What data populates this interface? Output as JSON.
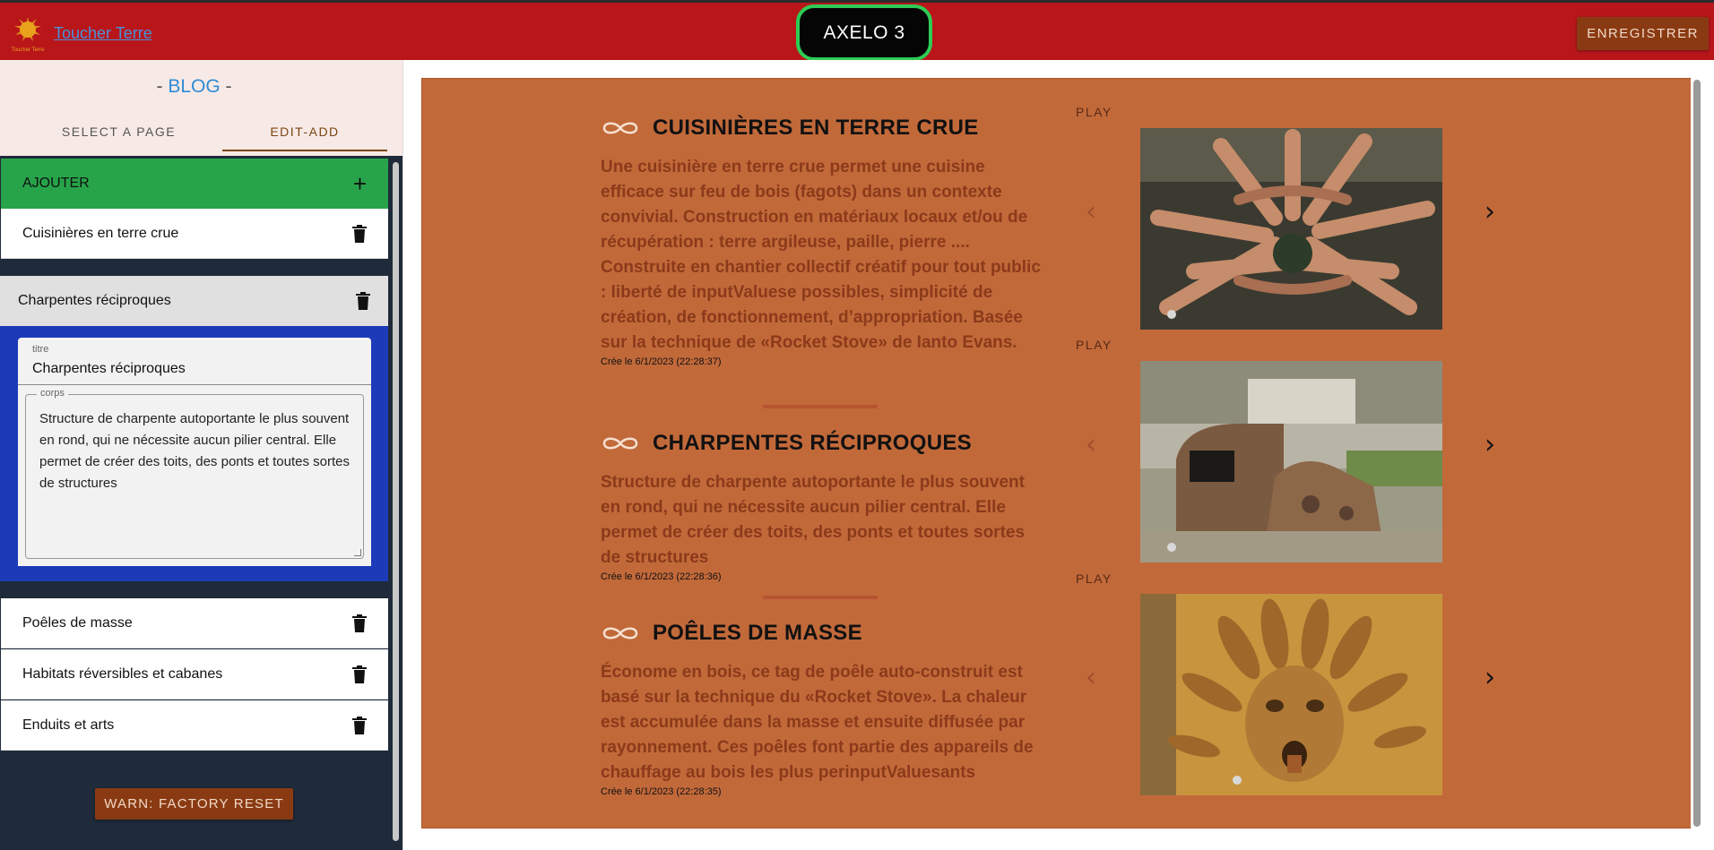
{
  "header": {
    "site_link": "Toucher Terre",
    "logo_text": "Toucher Terre",
    "center_badge": "AXELO 3",
    "save_label": "ENREGISTRER"
  },
  "sidebar": {
    "title_prefix": "- ",
    "title_accent": "BLOG",
    "title_suffix": " -",
    "tabs": [
      {
        "label": "SELECT A PAGE",
        "active": false
      },
      {
        "label": "EDIT-ADD",
        "active": true
      }
    ],
    "add_label": "AJOUTER",
    "items": [
      {
        "label": "Cuisinières en terre crue"
      },
      {
        "label": "Charpentes réciproques"
      },
      {
        "label": "Poêles de masse"
      },
      {
        "label": "Habitats réversibles et cabanes"
      },
      {
        "label": "Enduits et arts"
      }
    ],
    "editor": {
      "titre_label": "titre",
      "titre_value": "Charpentes réciproques",
      "corps_label": "corps",
      "corps_value": "Structure de charpente autoportante le plus souvent en rond, qui ne nécessite aucun pilier central. Elle permet de créer des toits, des ponts et toutes sortes de structures"
    },
    "reset_label": "WARN: FACTORY RESET"
  },
  "preview": {
    "play_label": "PLAY",
    "articles": [
      {
        "title": "CUISINIÈRES EN TERRE CRUE",
        "body": "Une cuisinière en terre crue permet une cuisine efficace sur feu de bois (fagots) dans un contexte convivial. Construction en matériaux locaux et/ou de récupération : terre argileuse, paille, pierre .... Construite en chantier collectif créatif pour tout public : liberté de inputValuese possibles, simplicité de création, de fonctionnement, d’appropriation. Basée sur la technique de «Rocket Stove» de Ianto Evans.",
        "date": "Crée le 6/1/2023 (22:28:37)"
      },
      {
        "title": "CHARPENTES RÉCIPROQUES",
        "body": "Structure de charpente autoportante le plus souvent en rond, qui ne nécessite aucun pilier central. Elle permet de créer des toits, des ponts et toutes sortes de structures",
        "date": "Crée le 6/1/2023 (22:28:36)"
      },
      {
        "title": "POÊLES DE MASSE",
        "body": "Économe en bois, ce tag de poêle auto-construit est basé sur la technique du «Rocket Stove». La chaleur est accumulée dans la masse et ensuite diffusée par rayonnement. Ces poêles font partie des appareils de chauffage au bois les plus perinputValuesants",
        "date": "Crée le 6/1/2023 (22:28:35)"
      }
    ]
  },
  "colors": {
    "topbar": "#b9161a",
    "accent_green": "#27a44a",
    "button_brown": "#8a3a12",
    "editor_blue": "#1d3ab8",
    "preview_bg": "#c2693a"
  }
}
